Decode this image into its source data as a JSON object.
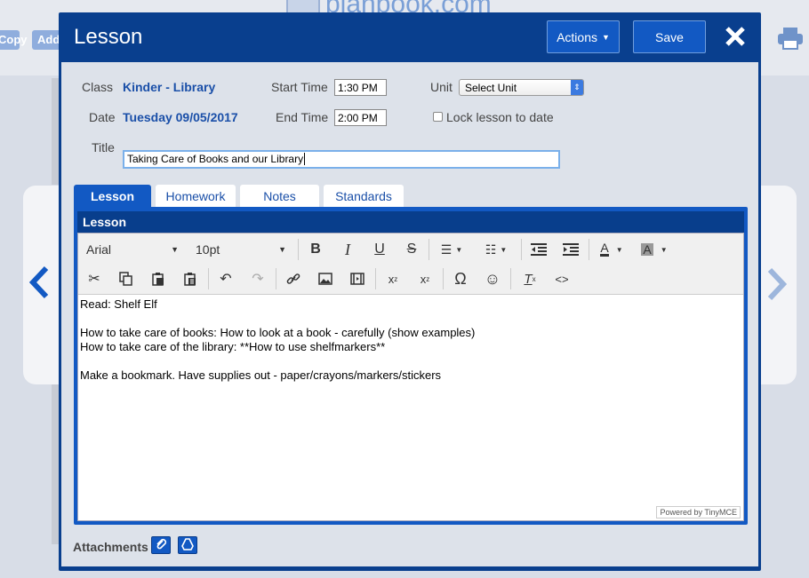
{
  "background": {
    "logo_text": "planbook.com",
    "buttons": [
      "Copy",
      "Add"
    ]
  },
  "modal": {
    "title": "Lesson",
    "actions_label": "Actions",
    "save_label": "Save",
    "fields": {
      "class_label": "Class",
      "class_value": "Kinder - Library",
      "date_label": "Date",
      "date_value": "Tuesday 09/05/2017",
      "start_label": "Start Time",
      "start_value": "1:30 PM",
      "end_label": "End Time",
      "end_value": "2:00 PM",
      "unit_label": "Unit",
      "unit_value": "Select Unit",
      "lock_label": "Lock lesson to date",
      "title_label": "Title",
      "title_value": "Taking Care of Books and our Library"
    },
    "tabs": [
      {
        "label": "Lesson",
        "active": true
      },
      {
        "label": "Homework",
        "active": false
      },
      {
        "label": "Notes",
        "active": false
      },
      {
        "label": "Standards",
        "active": false
      }
    ],
    "section_title": "Lesson",
    "editor": {
      "font_name": "Arial",
      "font_size": "10pt",
      "content": [
        "Read: Shelf Elf",
        "",
        "How to take care of books: How to look at a book - carefully (show examples)",
        "How to take care of the library: **How to use shelfmarkers**",
        "",
        "Make a bookmark. Have supplies out - paper/crayons/markers/stickers"
      ],
      "powered_by": "Powered by TinyMCE"
    },
    "attachments_label": "Attachments"
  }
}
